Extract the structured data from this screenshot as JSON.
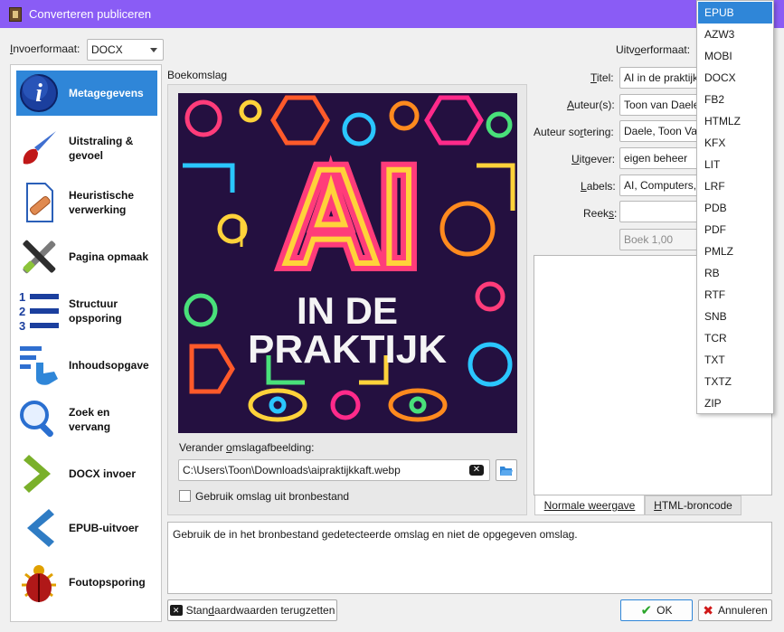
{
  "window": {
    "title": "Converteren publiceren"
  },
  "input_format": {
    "label_pre": "",
    "label_u": "I",
    "label_post": "nvoerformaat:",
    "value": "DOCX"
  },
  "output_format": {
    "label_pre": "Uitv",
    "label_u": "o",
    "label_post": "erformaat:"
  },
  "sidebar": {
    "items": [
      {
        "label": "Metagegevens",
        "icon": "info-icon",
        "active": true
      },
      {
        "label": "Uitstraling &\ngevoel",
        "icon": "paintbrush-icon",
        "active": false
      },
      {
        "label": "Heuristische\nverwerking",
        "icon": "document-bandage-icon",
        "active": false
      },
      {
        "label": "Pagina opmaak",
        "icon": "tools-icon",
        "active": false
      },
      {
        "label": "Structuur\nopsporing",
        "icon": "numbered-list-icon",
        "active": false
      },
      {
        "label": "Inhoudsopgave",
        "icon": "toc-pointer-icon",
        "active": false
      },
      {
        "label": "Zoek en\nvervang",
        "icon": "magnifier-icon",
        "active": false
      },
      {
        "label": "DOCX invoer",
        "icon": "chevron-right-icon",
        "active": false
      },
      {
        "label": "EPUB-uitvoer",
        "icon": "chevron-left-icon",
        "active": false
      },
      {
        "label": "Foutopsporing",
        "icon": "bug-icon",
        "active": false
      }
    ]
  },
  "cover": {
    "section_label": "Boekomslag",
    "art_line1": "AI",
    "art_line2": "IN DE",
    "art_line3": "PRAKTIJK",
    "change_label_pre": "Verander ",
    "change_label_u": "o",
    "change_label_post": "mslagafbeelding:",
    "path": "C:\\Users\\Toon\\Downloads\\aipraktijkkaft.webp",
    "use_source_label": "Gebruik omslag uit bronbestand"
  },
  "metadata": {
    "title_label_u": "T",
    "title_label_post": "itel:",
    "title_value": "AI in de praktijk",
    "author_label_u": "A",
    "author_label_post": "uteur(s):",
    "author_value": "Toon van Daele",
    "author_sort_label_pre": "Auteur so",
    "author_sort_label_u": "r",
    "author_sort_label_post": "tering:",
    "author_sort_value": "Daele, Toon Van",
    "publisher_label_u": "U",
    "publisher_label_post": "itgever:",
    "publisher_value": "eigen beheer",
    "tags_label_u": "L",
    "tags_label_post": "abels:",
    "tags_value": "AI, Computers,",
    "series_label_pre": "Reek",
    "series_label_u": "s",
    "series_label_post": ":",
    "series_value": "",
    "series_index": "Boek 1,00"
  },
  "comments": {
    "tab_normal": "Normale weergave",
    "tab_html_u": "H",
    "tab_html_post": "TML-broncode"
  },
  "help_text": "Gebruik de in het bronbestand gedetecteerde omslag en niet de opgegeven omslag.",
  "buttons": {
    "reset_pre": "Stan",
    "reset_u": "d",
    "reset_post": "aardwaarden terugzetten",
    "ok": "OK",
    "cancel": "Annuleren"
  },
  "format_dropdown": {
    "options": [
      "EPUB",
      "AZW3",
      "MOBI",
      "DOCX",
      "FB2",
      "HTMLZ",
      "KFX",
      "LIT",
      "LRF",
      "PDB",
      "PDF",
      "PMLZ",
      "RB",
      "RTF",
      "SNB",
      "TCR",
      "TXT",
      "TXTZ",
      "ZIP"
    ],
    "selected": "EPUB"
  },
  "colors": {
    "titlebar": "#8a5cf5",
    "selection": "#2f86d8",
    "ok_check": "#2aa52a",
    "cancel_x": "#d01818"
  }
}
